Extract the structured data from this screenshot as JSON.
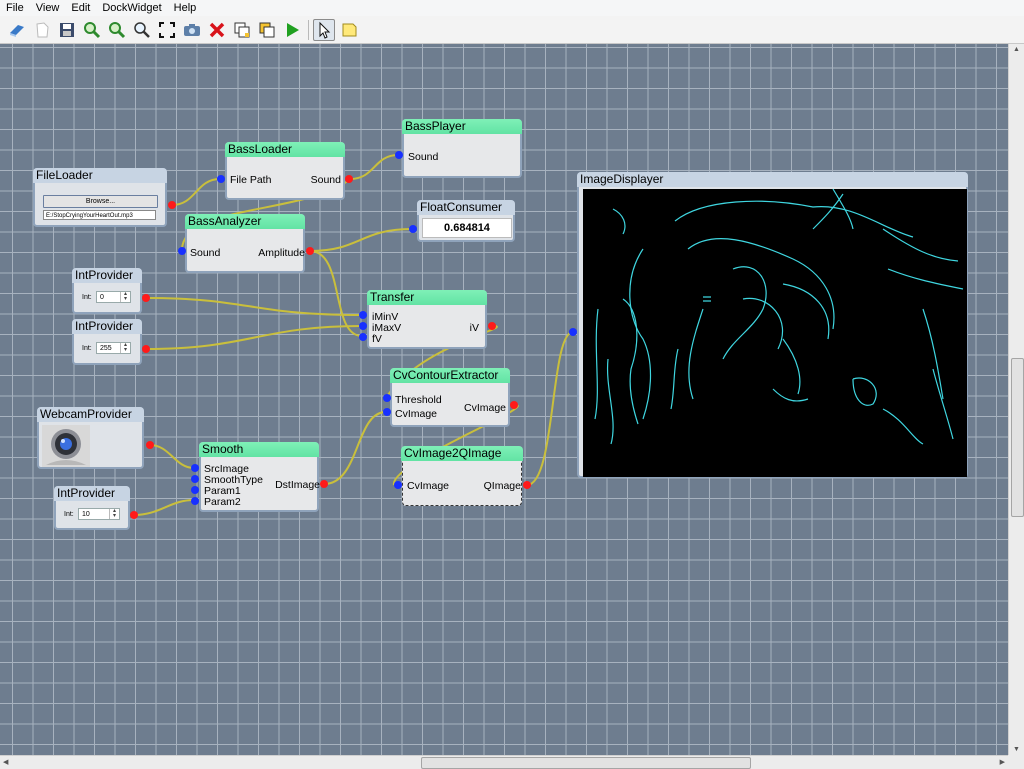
{
  "menu": [
    "File",
    "View",
    "Edit",
    "DockWidget",
    "Help"
  ],
  "toolbar": [
    "new-icon",
    "blank-page-icon",
    "save-icon",
    "zoom-in-icon",
    "zoom-out-icon",
    "zoom-fit-icon",
    "fullscreen-icon",
    "camera-icon",
    "delete-icon",
    "copy-icon",
    "paste-icon",
    "play-icon",
    "select-pointer-icon",
    "note-icon"
  ],
  "nodes": {
    "file_loader": {
      "title": "FileLoader",
      "browse": "Browse...",
      "path": "E:/StopCryingYourHeartOut.mp3"
    },
    "bass_loader": {
      "title": "BassLoader",
      "in": "File Path",
      "out": "Sound"
    },
    "bass_player": {
      "title": "BassPlayer",
      "in": "Sound"
    },
    "bass_analyzer": {
      "title": "BassAnalyzer",
      "in": "Sound",
      "out": "Amplitude"
    },
    "float_consumer": {
      "title": "FloatConsumer",
      "value": "0.684814"
    },
    "int_provider_1": {
      "title": "IntProvider",
      "label": "Int:",
      "value": "0"
    },
    "int_provider_2": {
      "title": "IntProvider",
      "label": "Int:",
      "value": "255"
    },
    "transfer": {
      "title": "Transfer",
      "in1": "iMinV",
      "in2": "iMaxV",
      "in3": "fV",
      "out": "iV"
    },
    "cv_contour": {
      "title": "CvContourExtractor",
      "in1": "Threshold",
      "in2": "CvImage",
      "out": "CvImage"
    },
    "webcam": {
      "title": "WebcamProvider"
    },
    "smooth": {
      "title": "Smooth",
      "in1": "SrcImage",
      "in2": "SmoothType",
      "in3": "Param1",
      "in4": "Param2",
      "out": "DstImage"
    },
    "cv2q": {
      "title": "CvImage2QImage",
      "in": "CvImage",
      "out": "QImage"
    },
    "int_provider_3": {
      "title": "IntProvider",
      "label": "Int:",
      "value": "10"
    },
    "image_displayer": {
      "title": "ImageDisplayer"
    }
  },
  "colors": {
    "canvas": "#6e7d8f",
    "grid": "#a7b2bf",
    "header": "#6ee8aa",
    "wire": "#c9bf3c",
    "in_pin": "#1830ff",
    "out_pin": "#ff1a1a",
    "contour": "#3fd6e0"
  }
}
